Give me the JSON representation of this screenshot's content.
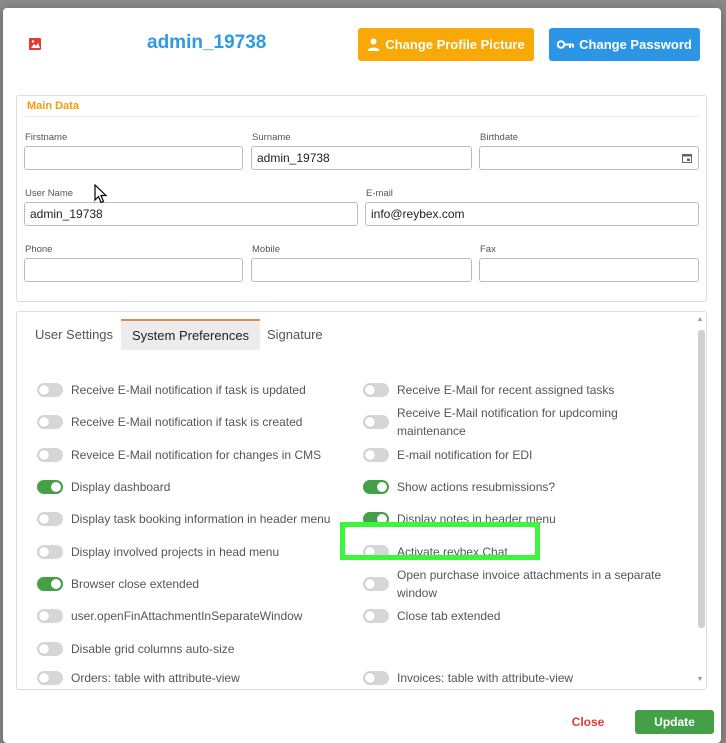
{
  "header": {
    "username": "admin_19738",
    "change_picture_label": "Change Profile Picture",
    "change_password_label": "Change Password",
    "picture_icon": "image-icon",
    "colors": {
      "accent": "#2e9ae0",
      "warning": "#f8a908",
      "primary": "#2d95e6"
    }
  },
  "main_data": {
    "title": "Main Data",
    "fields": {
      "firstname": {
        "label": "Firstname",
        "value": ""
      },
      "surname": {
        "label": "Surname",
        "value": "admin_19738"
      },
      "birthdate": {
        "label": "Birthdate",
        "value": ""
      },
      "username": {
        "label": "User Name",
        "value": "admin_19738"
      },
      "email": {
        "label": "E-mail",
        "value": "info@reybex.com"
      },
      "phone": {
        "label": "Phone",
        "value": ""
      },
      "mobile": {
        "label": "Mobile",
        "value": ""
      },
      "fax": {
        "label": "Fax",
        "value": ""
      }
    }
  },
  "tabs": [
    {
      "label": "User Settings",
      "active": false
    },
    {
      "label": "System Preferences",
      "active": true
    },
    {
      "label": "Signature",
      "active": false
    }
  ],
  "preferences": {
    "left": [
      {
        "label": "Receive E-Mail notification if task is updated",
        "on": false
      },
      {
        "label": "Receive E-Mail notification if task is created",
        "on": false
      },
      {
        "label": "Reveice E-Mail notification for changes in CMS",
        "on": false
      },
      {
        "label": "Display dashboard",
        "on": true
      },
      {
        "label": "Display task booking information in header menu",
        "on": false
      },
      {
        "label": "Display involved projects in head menu",
        "on": false
      },
      {
        "label": "Browser close extended",
        "on": true
      },
      {
        "label": "user.openFinAttachmentInSeparateWindow",
        "on": false
      },
      {
        "label": "Disable grid columns auto-size",
        "on": false
      },
      {
        "label": "Orders: table with attribute-view",
        "on": false
      }
    ],
    "right": [
      {
        "label": "Receive E-Mail for recent assigned tasks",
        "on": false
      },
      {
        "label": "Receive E-Mail notification for updcoming maintenance",
        "on": false
      },
      {
        "label": "E-mail notification for EDI",
        "on": false
      },
      {
        "label": "Show actions resubmissions?",
        "on": true
      },
      {
        "label": "Display notes in header menu",
        "on": true
      },
      {
        "label": "Activate reybex Chat",
        "on": false
      },
      {
        "label": "Open purchase invoice attachments in a separate window",
        "on": false
      },
      {
        "label": "Close tab extended",
        "on": false
      },
      {
        "label": "Invoices: table with attribute-view",
        "on": false
      }
    ]
  },
  "footer": {
    "close_label": "Close",
    "update_label": "Update"
  }
}
